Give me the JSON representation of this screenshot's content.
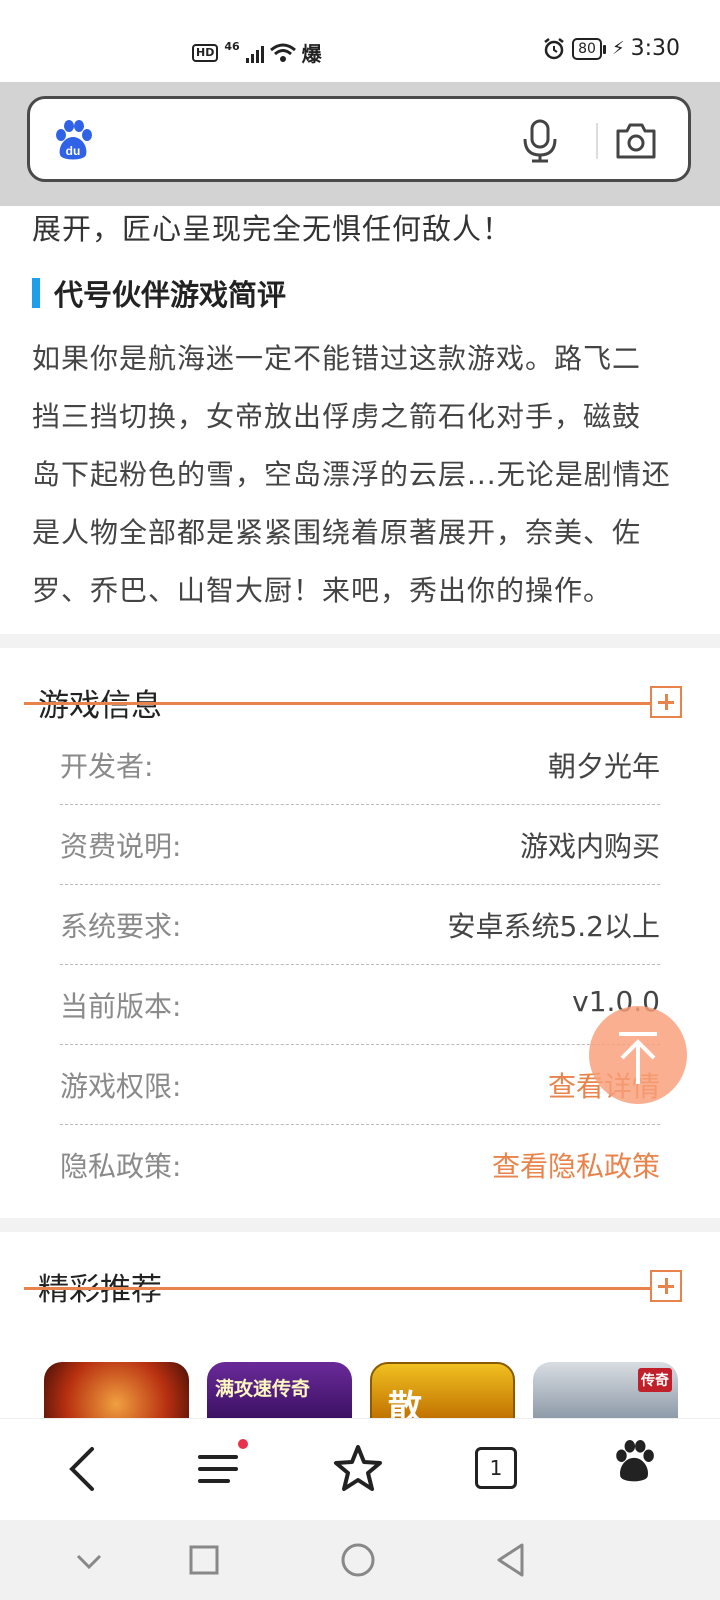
{
  "status_bar": {
    "hd": "HD",
    "signal": "46",
    "extra_icon": "爆",
    "battery": "80",
    "time": "3:30"
  },
  "search": {
    "logo_text": "du",
    "icons": [
      "baidu-paw-icon",
      "microphone-icon",
      "camera-icon"
    ]
  },
  "article": {
    "lead_line": "展开，匠心呈现完全无惧任何敌人！",
    "review_heading": "代号伙伴游戏简评",
    "review_lines": [
      "如果你是航海迷一定不能错过这款游戏。路飞二",
      "挡三挡切换，女帝放出俘虏之箭石化对手，磁鼓",
      "岛下起粉色的雪，空岛漂浮的云层...无论是剧情还",
      "是人物全部都是紧紧围绕着原著展开，奈美、佐",
      "罗、乔巴、山智大厨！来吧，秀出你的操作。"
    ]
  },
  "game_info": {
    "title": "游戏信息",
    "rows": [
      {
        "label": "开发者:",
        "value": "朝夕光年"
      },
      {
        "label": "资费说明:",
        "value": "游戏内购买"
      },
      {
        "label": "系统要求:",
        "value": "安卓系统5.2以上"
      },
      {
        "label": "当前版本:",
        "value": "v1.0.0"
      },
      {
        "label": "游戏权限:",
        "value": "查看详情"
      },
      {
        "label": "隐私政策:",
        "value": "查看隐私政策"
      }
    ]
  },
  "recommend": {
    "title": "精彩推荐",
    "items": [
      {
        "label": ""
      },
      {
        "label": "满攻速传奇"
      },
      {
        "label": "散"
      },
      {
        "label": "传奇"
      }
    ]
  },
  "bottom_nav": {
    "tab_count": "1",
    "icons": [
      "back-arrow-icon",
      "menu-icon",
      "star-icon",
      "tabs-icon",
      "baidu-paw-icon"
    ]
  },
  "colors": {
    "accent": "#e9834c",
    "heading_bar": "#1e9fe9",
    "back_to_top": "#f89e78"
  }
}
